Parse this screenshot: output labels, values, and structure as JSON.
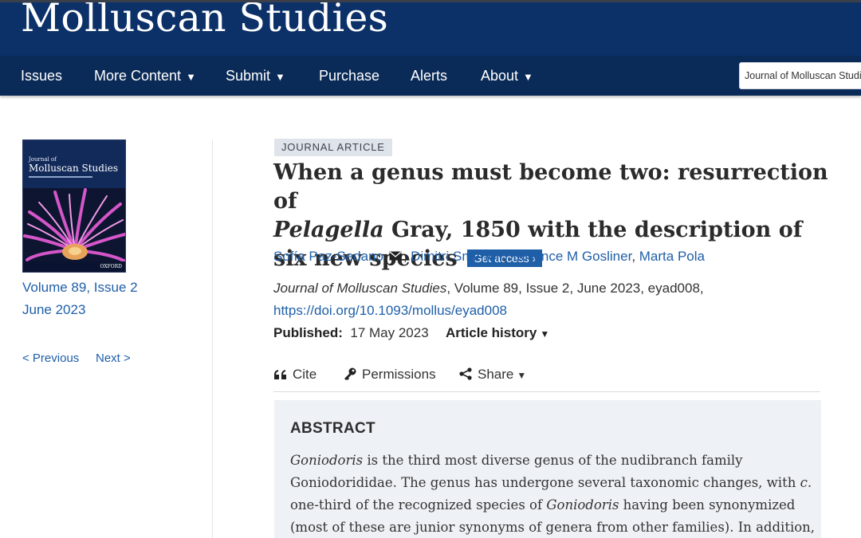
{
  "header": {
    "brand": "Molluscan Studies"
  },
  "nav": {
    "items": [
      {
        "label": "Issues",
        "dropdown": false
      },
      {
        "label": "More Content",
        "dropdown": true
      },
      {
        "label": "Submit",
        "dropdown": true
      },
      {
        "label": "Purchase",
        "dropdown": false
      },
      {
        "label": "Alerts",
        "dropdown": false
      },
      {
        "label": "About",
        "dropdown": true
      }
    ],
    "journal_select": "Journal of Molluscan Studies"
  },
  "sidebar": {
    "cover": {
      "journal_small": "Journal of",
      "journal_title": "Molluscan Studies",
      "publisher": "OXFORD"
    },
    "volume_issue": "Volume 89, Issue 2",
    "date": "June 2023",
    "previous": "< Previous",
    "next": "Next >"
  },
  "article": {
    "type_tag": "JOURNAL ARTICLE",
    "title_part1": "When a genus must become two: resurrection of",
    "title_italic": "Pelagella",
    "title_part2": " Gray, 1850 with the description of six new species",
    "get_access": "Get access",
    "authors": [
      "Sofía Paz-Sedano",
      "Dimitri Smirnoff",
      "Terrence M Gosliner",
      "Marta Pola"
    ],
    "citation_journal": "Journal of Molluscan Studies",
    "citation_rest": ", Volume 89, Issue 2, June 2023, eyad008,",
    "doi": "https://doi.org/10.1093/mollus/eyad008",
    "published_label": "Published:",
    "published_date": "17 May 2023",
    "article_history": "Article history"
  },
  "tools": {
    "cite": "Cite",
    "permissions": "Permissions",
    "share": "Share"
  },
  "abstract": {
    "heading": "ABSTRACT",
    "line1_italic": "Goniodoris",
    "line1_rest": " is the third most diverse genus of the nudibranch family",
    "line2_pre": "Goniodorididae. The genus has undergone several taxonomic changes, with ",
    "line2_italic": "c.",
    "line3_pre": "one-third of the recognized species of ",
    "line3_italic": "Goniodoris",
    "line3_rest": " having been synonymized",
    "line4": "(most of these are junior synonyms of genera from other families). In addition,"
  },
  "colors": {
    "banner": "#0b3168",
    "nav": "#0a2a57",
    "link": "#1f5fa8",
    "abstract_bg": "#eef1f5"
  }
}
